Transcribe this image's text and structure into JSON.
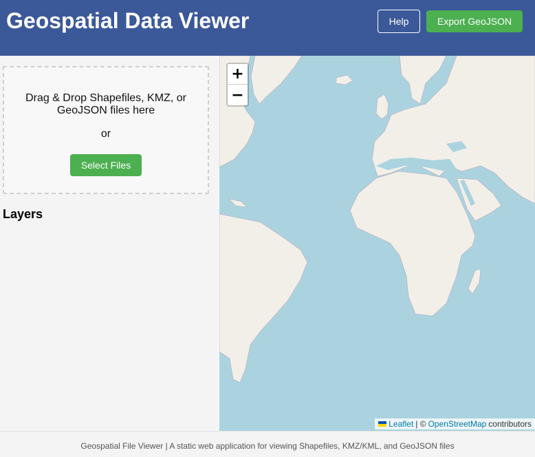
{
  "header": {
    "title": "Geospatial Data Viewer",
    "help_label": "Help",
    "export_label": "Export GeoJSON"
  },
  "sidebar": {
    "dropzone_text": "Drag & Drop Shapefiles, KMZ, or GeoJSON files here",
    "or_text": "or",
    "select_label": "Select Files",
    "layers_title": "Layers"
  },
  "map": {
    "zoom_in_label": "+",
    "zoom_out_label": "−",
    "attribution": {
      "leaflet": "Leaflet",
      "separator": "| ©",
      "osm": "OpenStreetMap",
      "contributors": "contributors"
    }
  },
  "footer": {
    "text": "Geospatial File Viewer | A static web application for viewing Shapefiles, KMZ/KML, and GeoJSON files"
  },
  "colors": {
    "header_bg": "#3b5998",
    "button_green": "#4caf50",
    "ocean": "#aad3df",
    "land": "#f2efe9",
    "link": "#0078a8"
  }
}
